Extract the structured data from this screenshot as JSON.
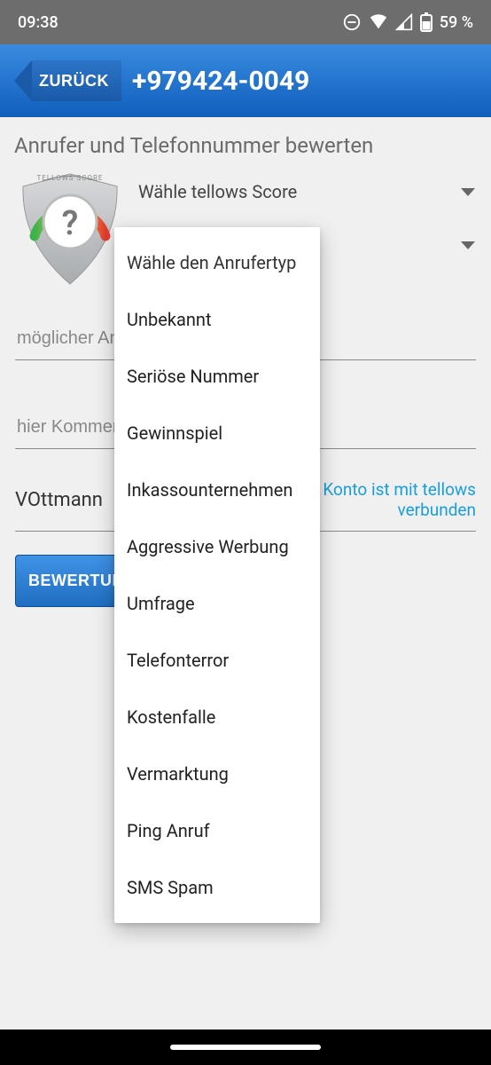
{
  "status": {
    "time": "09:38",
    "battery": "59 %"
  },
  "appbar": {
    "back": "ZURÜCK",
    "title": "+979424-0049"
  },
  "heading": "Anrufer und Telefonnummer bewerten",
  "badge_label": "TELLOWS SCORE",
  "select_score": "Wähle tellows Score",
  "select_type": "Wähle den Anrufertyp",
  "input_name_placeholder": "möglicher Anrufername",
  "input_comment_placeholder": "hier Kommentar eingeben",
  "user_name": "VOttmann",
  "user_status": "Konto ist mit tellows verbunden",
  "submit": "BEWERTUNG SPEICHERN",
  "dropdown": {
    "header": "Wähle den Anrufertyp",
    "options": [
      "Unbekannt",
      "Seriöse Nummer",
      "Gewinnspiel",
      "Inkassounternehmen",
      "Aggressive Werbung",
      "Umfrage",
      "Telefonterror",
      "Kostenfalle",
      "Vermarktung",
      "Ping Anruf",
      "SMS Spam"
    ]
  }
}
